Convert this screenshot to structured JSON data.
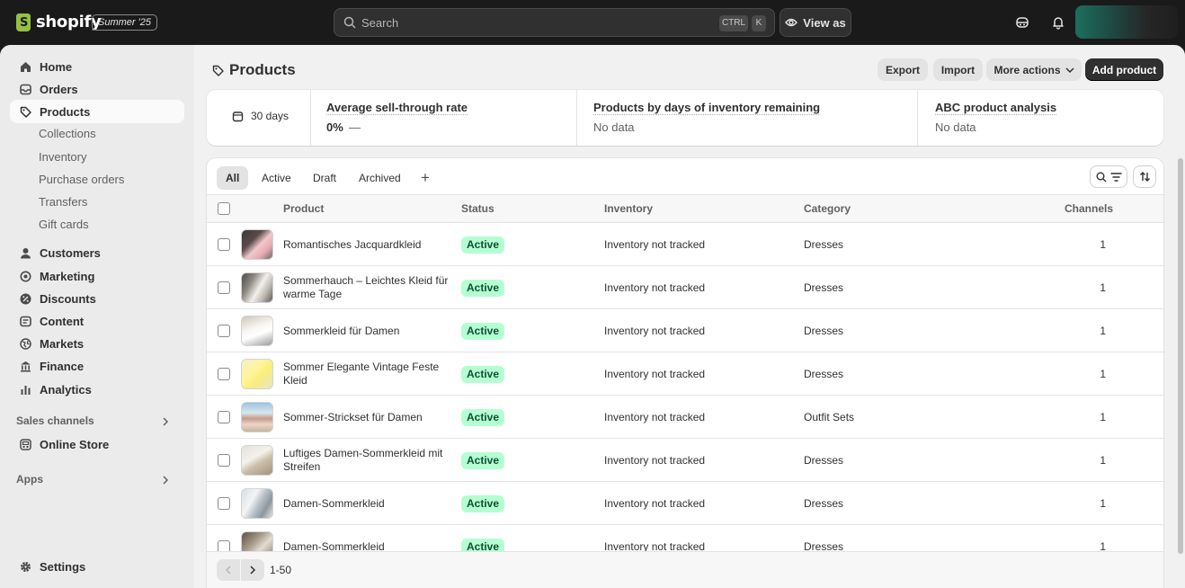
{
  "topbar": {
    "logo_text": "shopify",
    "edition": "Summer '25",
    "search_placeholder": "Search",
    "shortcut_ctrl": "CTRL",
    "shortcut_k": "K",
    "view_as": "View as"
  },
  "sidebar": {
    "items": [
      {
        "label": "Home",
        "icon": "home-icon"
      },
      {
        "label": "Orders",
        "icon": "inbox-icon"
      },
      {
        "label": "Products",
        "icon": "tag-icon",
        "active": true
      }
    ],
    "sub_items": [
      "Collections",
      "Inventory",
      "Purchase orders",
      "Transfers",
      "Gift cards"
    ],
    "items2": [
      {
        "label": "Customers",
        "icon": "person-icon"
      },
      {
        "label": "Marketing",
        "icon": "target-icon"
      },
      {
        "label": "Discounts",
        "icon": "discount-icon"
      },
      {
        "label": "Content",
        "icon": "content-icon"
      },
      {
        "label": "Markets",
        "icon": "globe-icon"
      },
      {
        "label": "Finance",
        "icon": "bank-icon"
      },
      {
        "label": "Analytics",
        "icon": "chart-icon"
      }
    ],
    "sales_channels": "Sales channels",
    "online_store": "Online Store",
    "apps": "Apps",
    "settings": "Settings"
  },
  "page": {
    "title": "Products",
    "export": "Export",
    "import": "Import",
    "more_actions": "More actions",
    "add_product": "Add product"
  },
  "stats": {
    "period": "30 days",
    "sell_through_title": "Average sell-through rate",
    "sell_through_value": "0%",
    "sell_through_trend": "—",
    "days_inventory_title": "Products by days of inventory remaining",
    "days_inventory_value": "No data",
    "abc_title": "ABC product analysis",
    "abc_value": "No data"
  },
  "tabs": [
    "All",
    "Active",
    "Draft",
    "Archived"
  ],
  "table": {
    "headers": {
      "product": "Product",
      "status": "Status",
      "inventory": "Inventory",
      "category": "Category",
      "channels": "Channels"
    },
    "rows": [
      {
        "name": "Romantisches Jacquardkleid",
        "status": "Active",
        "inventory": "Inventory not tracked",
        "category": "Dresses",
        "channels": "1"
      },
      {
        "name": "Sommerhauch – Leichtes Kleid für warme Tage",
        "status": "Active",
        "inventory": "Inventory not tracked",
        "category": "Dresses",
        "channels": "1"
      },
      {
        "name": "Sommerkleid für Damen",
        "status": "Active",
        "inventory": "Inventory not tracked",
        "category": "Dresses",
        "channels": "1"
      },
      {
        "name": "Sommer Elegante Vintage Feste Kleid",
        "status": "Active",
        "inventory": "Inventory not tracked",
        "category": "Dresses",
        "channels": "1"
      },
      {
        "name": "Sommer-Strickset für Damen",
        "status": "Active",
        "inventory": "Inventory not tracked",
        "category": "Outfit Sets",
        "channels": "1"
      },
      {
        "name": "Luftiges Damen-Sommerkleid mit Streifen",
        "status": "Active",
        "inventory": "Inventory not tracked",
        "category": "Dresses",
        "channels": "1"
      },
      {
        "name": "Damen-Sommerkleid",
        "status": "Active",
        "inventory": "Inventory not tracked",
        "category": "Dresses",
        "channels": "1"
      },
      {
        "name": "Damen-Sommerkleid",
        "status": "Active",
        "inventory": "Inventory not tracked",
        "category": "Dresses",
        "channels": "1"
      }
    ]
  },
  "pagination": {
    "range": "1-50"
  },
  "colors": {
    "active_badge_bg": "#b4fed2",
    "active_badge_text": "#0c5132",
    "primary_button": "#303030"
  }
}
